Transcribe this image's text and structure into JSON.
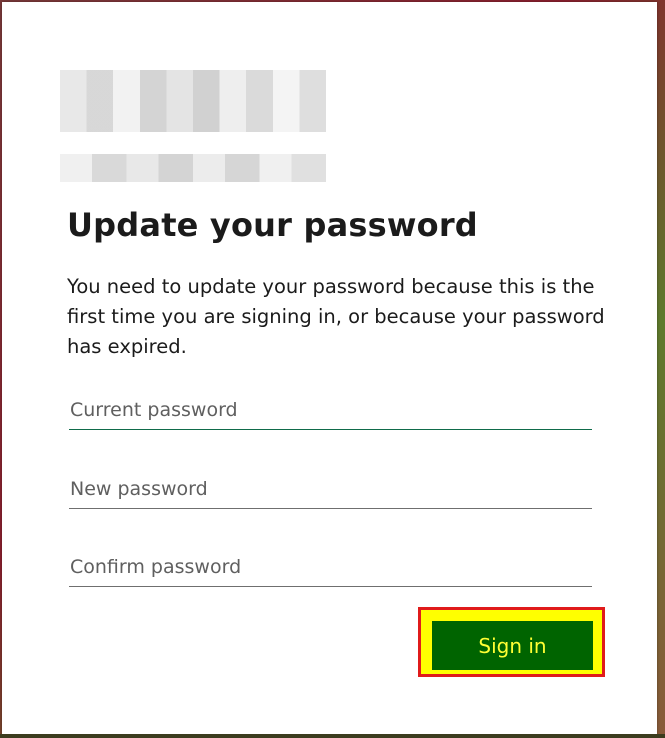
{
  "form": {
    "title": "Update your password",
    "description": "You need to update your password because this is the first time you are signing in, or because your password has expired.",
    "current_password": {
      "placeholder": "Current password",
      "value": ""
    },
    "new_password": {
      "placeholder": "New password",
      "value": ""
    },
    "confirm_password": {
      "placeholder": "Confirm password",
      "value": ""
    },
    "submit_label": "Sign in"
  },
  "colors": {
    "submit_bg": "#006400",
    "submit_text": "#ffff33",
    "highlight_fill": "#ffff00",
    "highlight_border": "#e01b1b"
  },
  "icons": {
    "logo": "organization-logo"
  }
}
